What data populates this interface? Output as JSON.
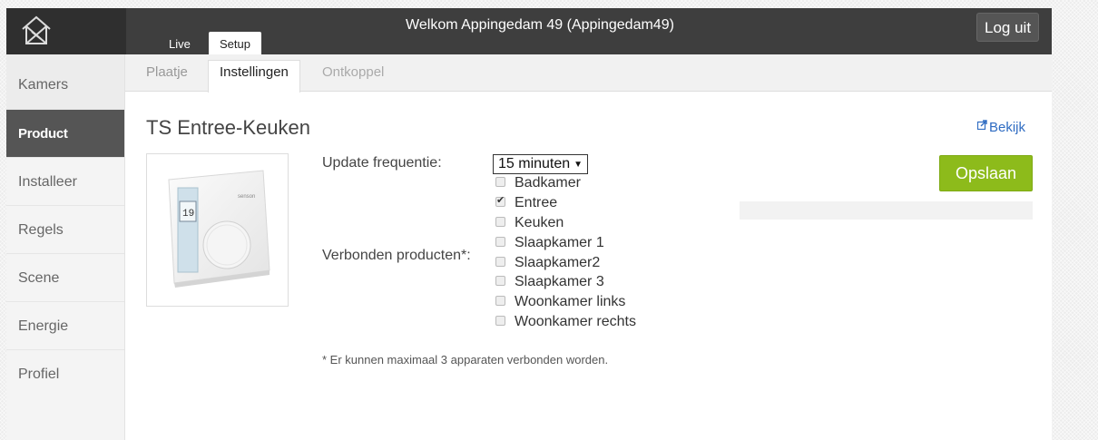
{
  "header": {
    "welcome_text": "Welkom Appingedam 49 (Appingedam49)",
    "logout_label": "Log uit",
    "tabs": [
      {
        "label": "Live"
      },
      {
        "label": "Setup",
        "active": true
      }
    ]
  },
  "sidebar": {
    "items": [
      {
        "label": "Kamers"
      },
      {
        "label": "Product",
        "active": true
      },
      {
        "label": "Installeer"
      },
      {
        "label": "Regels"
      },
      {
        "label": "Scene"
      },
      {
        "label": "Energie"
      },
      {
        "label": "Profiel"
      }
    ]
  },
  "subtabs": [
    {
      "label": "Plaatje"
    },
    {
      "label": "Instellingen",
      "active": true
    },
    {
      "label": "Ontkoppel"
    }
  ],
  "main": {
    "title": "TS Entree-Keuken",
    "view_link": "Bekijk",
    "update_frequency_label": "Update frequentie:",
    "update_frequency_value": "15 minuten",
    "connected_label": "Verbonden producten*:",
    "rooms": [
      {
        "label": "Badkamer",
        "checked": false
      },
      {
        "label": "Entree",
        "checked": true
      },
      {
        "label": "Keuken",
        "checked": false
      },
      {
        "label": "Slaapkamer 1",
        "checked": false
      },
      {
        "label": "Slaapkamer2",
        "checked": false
      },
      {
        "label": "Slaapkamer 3",
        "checked": false
      },
      {
        "label": "Woonkamer links",
        "checked": false
      },
      {
        "label": "Woonkamer rechts",
        "checked": false
      }
    ],
    "footnote": "* Er kunnen maximaal 3 apparaten verbonden worden.",
    "save_label": "Opslaan"
  },
  "colors": {
    "topbar": "#3e3e3e",
    "accent_green": "#8dbb1b",
    "link_blue": "#2f6cc2"
  },
  "icons": [
    "house-logo-icon",
    "external-link-icon",
    "chevron-down-icon",
    "checkbox-icon"
  ]
}
